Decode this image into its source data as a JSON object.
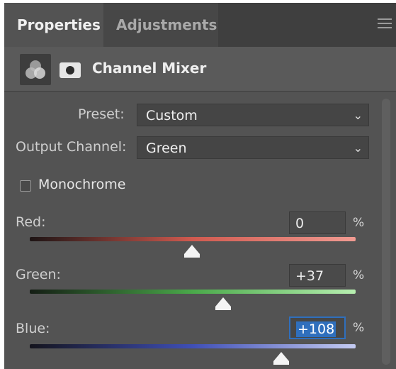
{
  "tabs": {
    "active": "Properties",
    "inactive": "Adjustments"
  },
  "header": {
    "title": "Channel Mixer"
  },
  "preset": {
    "label": "Preset:",
    "value": "Custom"
  },
  "output_channel": {
    "label": "Output Channel:",
    "value": "Green"
  },
  "monochrome": {
    "label": "Monochrome",
    "checked": false
  },
  "sliders": [
    {
      "label": "Red:",
      "value": "0",
      "unit": "%",
      "position_fraction": 0.53
    },
    {
      "label": "Green:",
      "value": "+37",
      "unit": "%",
      "position_fraction": 0.7
    },
    {
      "label": "Blue:",
      "value": "+108",
      "unit": "%",
      "position_fraction": 0.88
    }
  ],
  "colors": {
    "panel_bg": "#535353",
    "selection_blue": "#2f6fbd",
    "red_track": "#e06a5d",
    "green_track": "#8bd27a",
    "blue_track": "#6d7de0"
  },
  "icons": {
    "adjustment": "channel-mixer-icon",
    "mask": "layer-mask-icon",
    "menu": "hamburger-menu-icon",
    "dropdown": "chevron-down-icon"
  }
}
